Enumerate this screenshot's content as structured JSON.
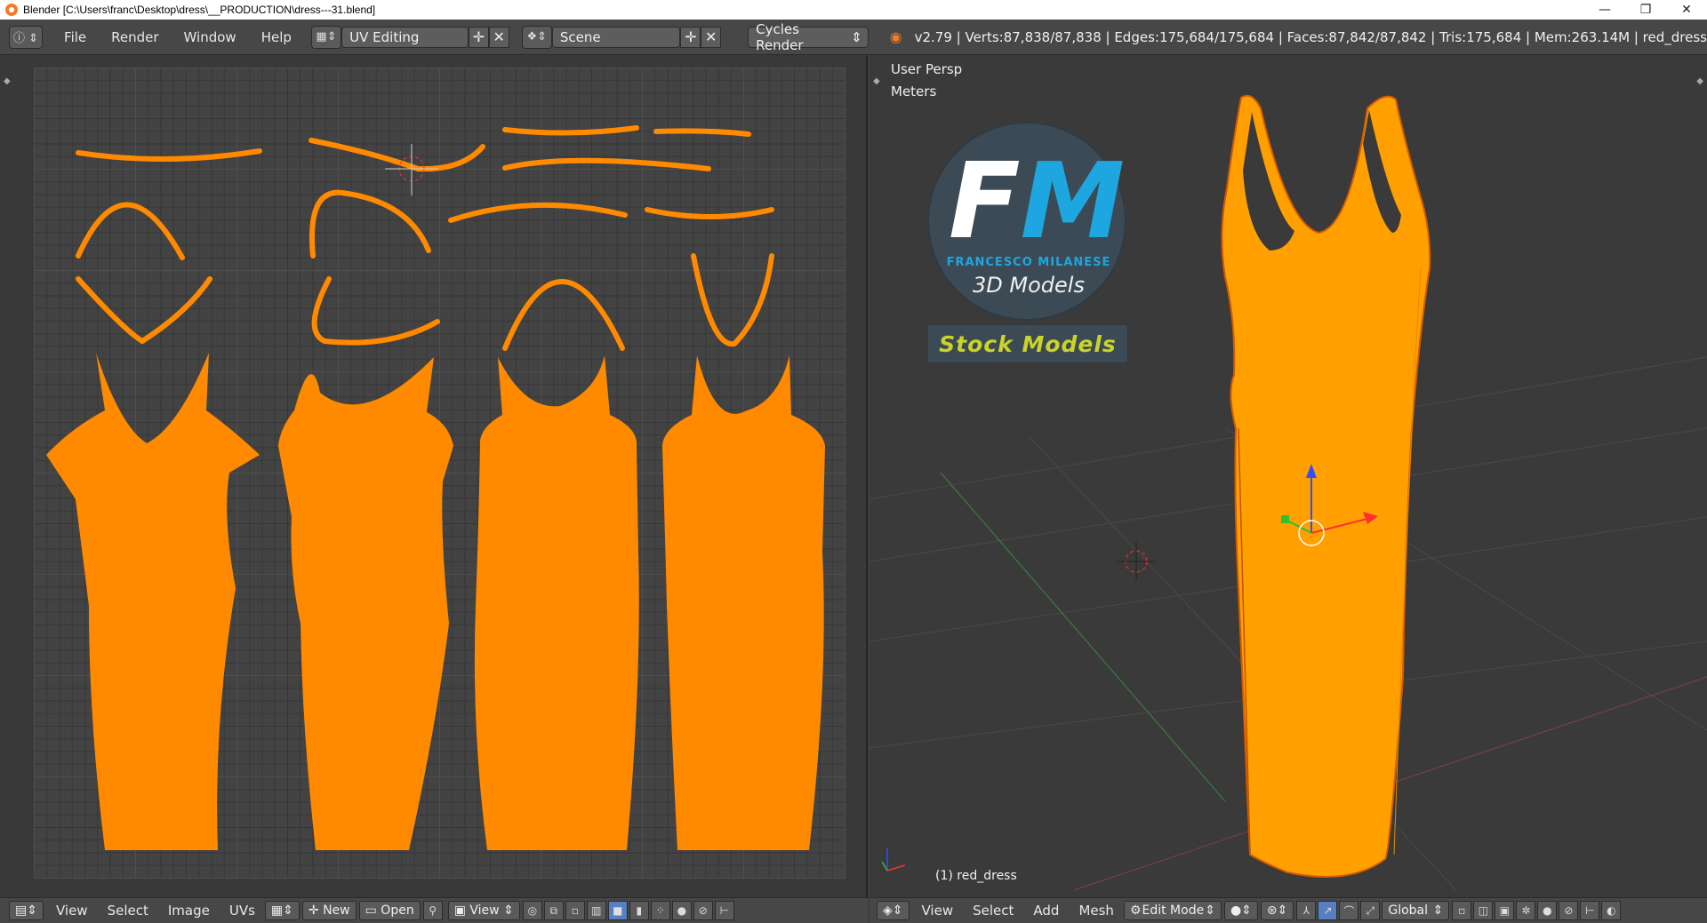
{
  "window": {
    "title": "Blender [C:\\Users\\franc\\Desktop\\dress\\__PRODUCTION\\dress---31.blend]",
    "minimize": "—",
    "maximize": "❐",
    "close": "✕"
  },
  "info_header": {
    "menus": [
      "File",
      "Render",
      "Window",
      "Help"
    ],
    "layout": "UV Editing",
    "scene": "Scene",
    "render_engine": "Cycles Render",
    "stats": "v2.79 | Verts:87,838/87,838 | Edges:175,684/175,684 | Faces:87,842/87,842 | Tris:175,684 | Mem:263.14M | red_dress"
  },
  "viewport": {
    "view_name": "User Persp",
    "units": "Meters",
    "object_label": "(1) red_dress",
    "logo": {
      "initials_f": "F",
      "initials_m": "M",
      "name": "FRANCESCO MILANESE",
      "subtitle": "3D Models",
      "banner": "Stock Models"
    }
  },
  "uv_footer": {
    "menus": [
      "View",
      "Select",
      "Image",
      "UVs"
    ],
    "new_label": "New",
    "open_label": "Open",
    "view_label": "View"
  },
  "viewport_footer": {
    "menus": [
      "View",
      "Select",
      "Add",
      "Mesh"
    ],
    "mode": "Edit Mode",
    "orientation": "Global"
  },
  "colors": {
    "uv_fill": "#ff8a00",
    "mesh": "#ffa000",
    "background": "#3d3d3d",
    "header": "#474747"
  }
}
